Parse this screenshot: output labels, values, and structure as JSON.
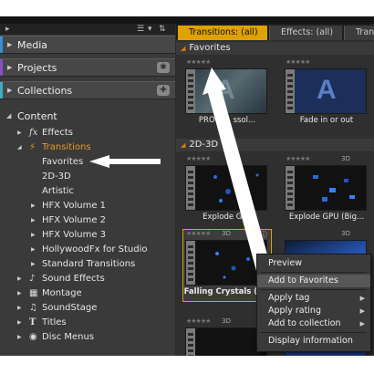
{
  "left_panel": {
    "library_rows": [
      {
        "label": "Media",
        "color": "#3a8fd6"
      },
      {
        "label": "Projects",
        "color": "#8a4fc4"
      },
      {
        "label": "Collections",
        "color": "#3ab0c0"
      }
    ],
    "content_label": "Content",
    "tree": [
      {
        "label": "Effects",
        "icon": "fx-icon",
        "glyph": "fx"
      },
      {
        "label": "Transitions",
        "icon": "lightning-icon",
        "glyph": "⚡"
      },
      {
        "label": "Favorites"
      },
      {
        "label": "2D-3D"
      },
      {
        "label": "Artistic"
      },
      {
        "label": "HFX Volume 1"
      },
      {
        "label": "HFX Volume 2"
      },
      {
        "label": "HFX Volume 3"
      },
      {
        "label": "HollywoodFx for Studio"
      },
      {
        "label": "Standard Transitions"
      },
      {
        "label": "Sound Effects",
        "icon": "music-note-icon",
        "glyph": "♪"
      },
      {
        "label": "Montage",
        "icon": "montage-icon",
        "glyph": "▦"
      },
      {
        "label": "SoundStage",
        "icon": "soundstage-icon",
        "glyph": "♫"
      },
      {
        "label": "Titles",
        "icon": "title-icon",
        "glyph": "T"
      },
      {
        "label": "Disc Menus",
        "icon": "disc-icon",
        "glyph": "◉"
      }
    ]
  },
  "tabs": [
    {
      "label": "Transitions: (all)"
    },
    {
      "label": "Effects: (all)"
    },
    {
      "label": "Trans"
    }
  ],
  "sections": {
    "favorites": "Favorites",
    "d23": "2D-3D"
  },
  "items": [
    {
      "caption": "PRO-Z... ssol...",
      "has3d": false
    },
    {
      "caption": "Fade in or out",
      "has3d": false
    },
    {
      "caption": "Explode Gl...",
      "has3d": false
    },
    {
      "caption": "Explode GPU (Big...",
      "has3d": true
    },
    {
      "caption": "Falling Crystals (F...",
      "has3d": true
    },
    {
      "caption": "",
      "has3d": true
    }
  ],
  "badge_3d": "3D",
  "context_menu": [
    {
      "label": "Preview",
      "submenu": false
    },
    {
      "label": "Add to Favorites",
      "submenu": false
    },
    {
      "label": "Apply tag",
      "submenu": true
    },
    {
      "label": "Apply rating",
      "submenu": true
    },
    {
      "label": "Add to collection",
      "submenu": true
    },
    {
      "label": "Display information",
      "submenu": false
    }
  ],
  "colors": {
    "accent": "#e0a200",
    "arrow": "#ffffff"
  }
}
